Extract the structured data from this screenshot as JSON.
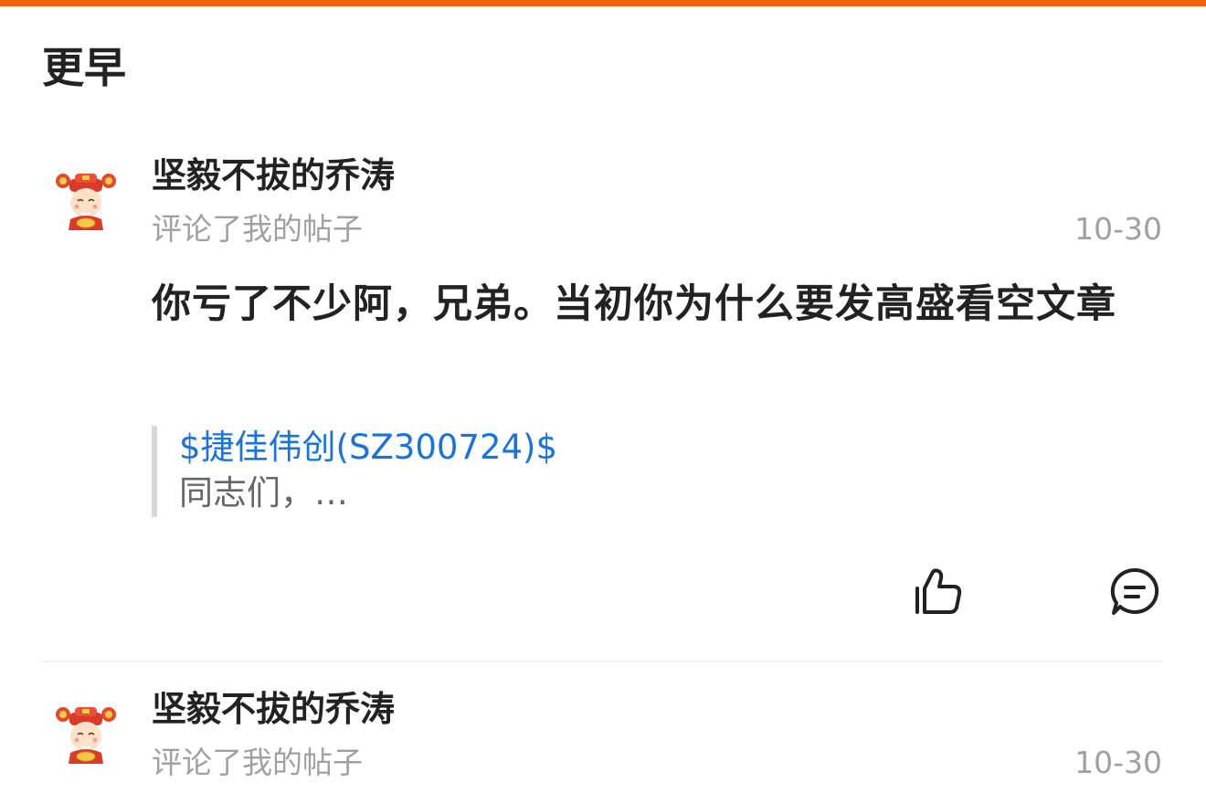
{
  "colors": {
    "accent": "#f5620f",
    "link": "#1a73d9",
    "muted": "#a0a0a0"
  },
  "section": {
    "title": "更早"
  },
  "notifications": [
    {
      "avatar_icon": "caishen-avatar",
      "author": "坚毅不拔的乔涛",
      "action": "评论了我的帖子",
      "date": "10-30",
      "comment": "你亏了不少阿，兄弟。当初你为什么要发高盛看空文章",
      "quote": {
        "link": "$捷佳伟创(SZ300724)$",
        "excerpt": "同志们，…"
      },
      "like_icon": "thumbs-up-icon",
      "reply_icon": "comment-icon"
    },
    {
      "avatar_icon": "caishen-avatar",
      "author": "坚毅不拔的乔涛",
      "action": "评论了我的帖子",
      "date": "10-30"
    }
  ]
}
